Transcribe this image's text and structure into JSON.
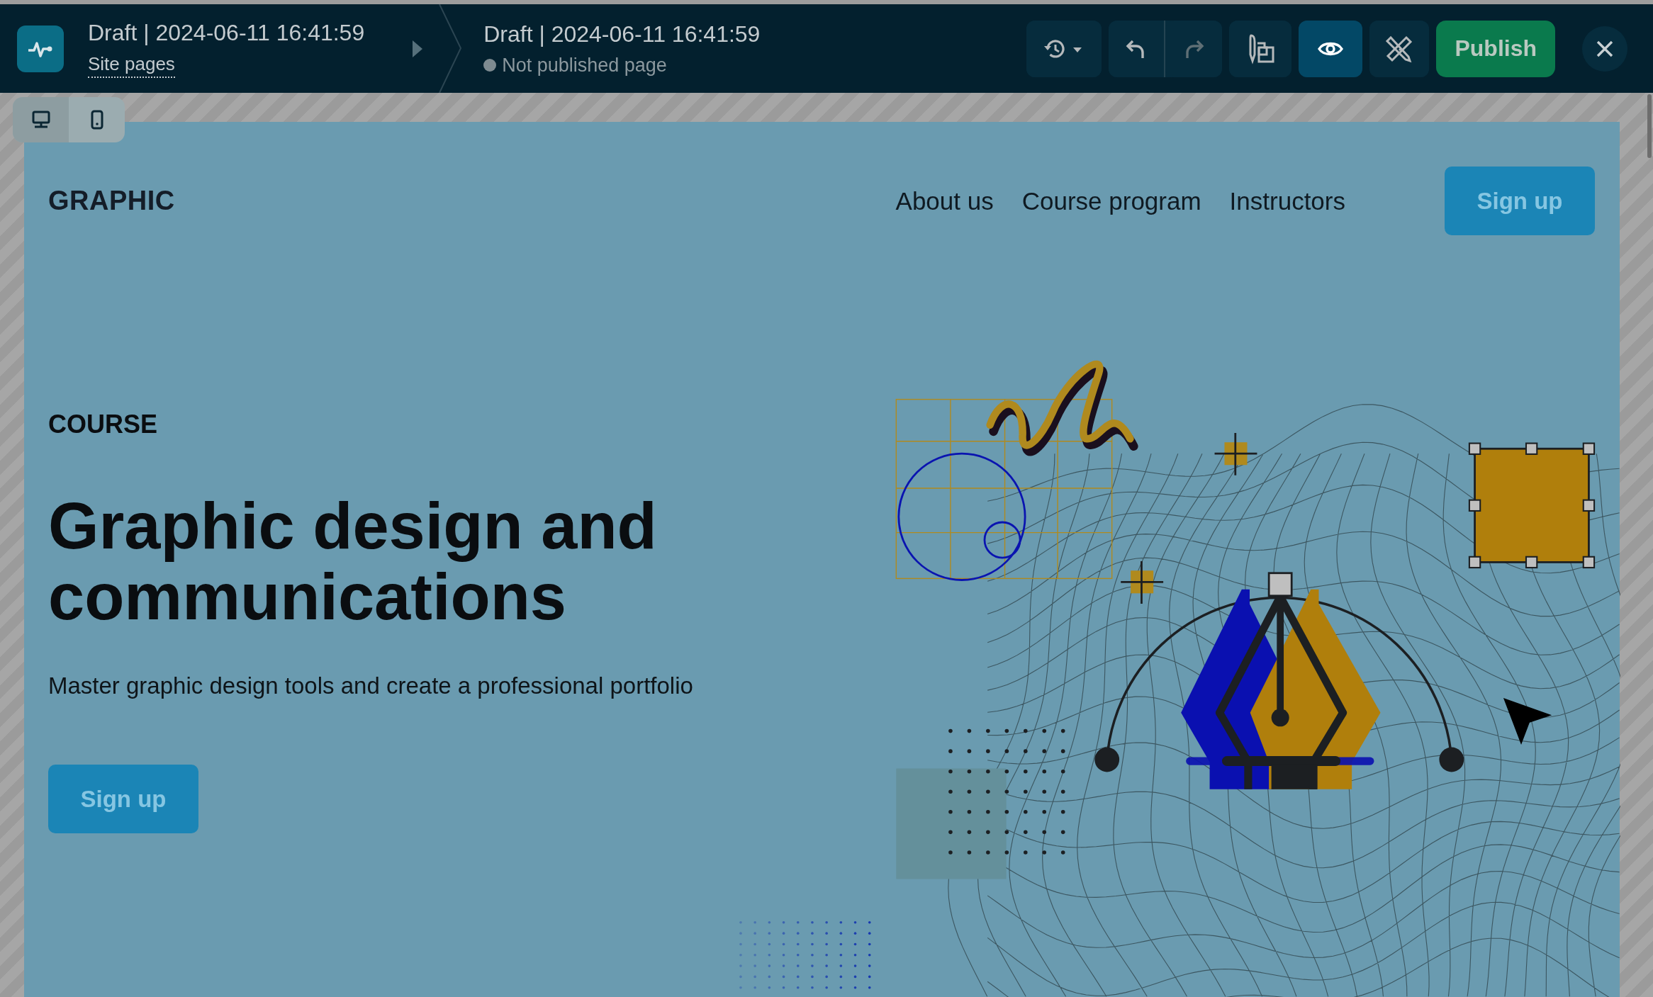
{
  "editor_bar": {
    "page_title": "Draft | 2024-06-11 16:41:59",
    "site_pages_link": "Site pages",
    "current_title": "Draft | 2024-06-11 16:41:59",
    "status": "Not published page",
    "published": false,
    "tools": [
      {
        "kind": "history",
        "selected": false,
        "disabled": false
      },
      {
        "kind": "undo",
        "selected": false,
        "disabled": false
      },
      {
        "kind": "redo",
        "selected": false,
        "disabled": true
      },
      {
        "kind": "style",
        "selected": false,
        "disabled": false
      },
      {
        "kind": "preview",
        "selected": true,
        "disabled": false
      },
      {
        "kind": "design",
        "selected": false,
        "disabled": false
      }
    ],
    "publish_button": "Publish"
  },
  "device_toggle": [
    {
      "kind": "desktop",
      "selected": true
    },
    {
      "kind": "mobile",
      "selected": false
    }
  ],
  "site": {
    "logo": "GRAPHIC",
    "nav": [
      "About us",
      "Course program",
      "Instructors"
    ],
    "header_button": "Sign up",
    "eyebrow": "COURSE",
    "heading": "Graphic design and communications",
    "subtitle": "Master graphic design tools and create a professional portfolio",
    "cta_button": "Sign up"
  }
}
